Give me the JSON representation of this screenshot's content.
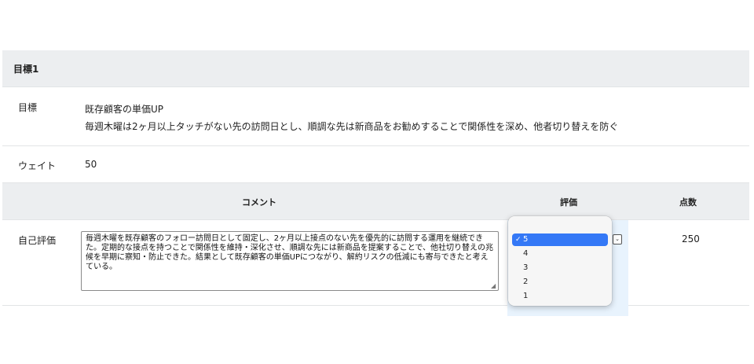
{
  "goal_section": {
    "header": "目標1",
    "goal_label": "目標",
    "goal_title": "既存顧客の単価UP",
    "goal_description": "毎週木曜は2ヶ月以上タッチがない先の訪問日とし、順調な先は新商品をお勧めすることで関係性を深め、他者切り替えを防ぐ",
    "weight_label": "ウェイト",
    "weight_value": "50"
  },
  "evaluation_table": {
    "headers": {
      "comment": "コメント",
      "rating": "評価",
      "score": "点数"
    },
    "self_eval": {
      "label": "自己評価",
      "comment": "毎週木曜を既存顧客のフォロー訪問日として固定し、2ヶ月以上接点のない先を優先的に訪問する運用を継続できた。定期的な接点を持つことで関係性を維持・深化させ、順調な先には新商品を提案することで、他社切り替えの兆候を早期に察知・防止できた。結果として既存顧客の単価UPにつながり、解約リスクの低減にも寄与できたと考えている。",
      "rating_selected": "5",
      "score": "250"
    }
  },
  "rating_dropdown": {
    "check_mark": "✓",
    "options": [
      "5",
      "4",
      "3",
      "2",
      "1"
    ]
  },
  "icons": {
    "select_arrow": "chevron-down-icon",
    "resize_grip": "resize-grip-icon"
  },
  "colors": {
    "header_bg": "#eceef0",
    "selected_option": "#3478f6",
    "rating_cell_highlight": "#e8f3fd"
  }
}
